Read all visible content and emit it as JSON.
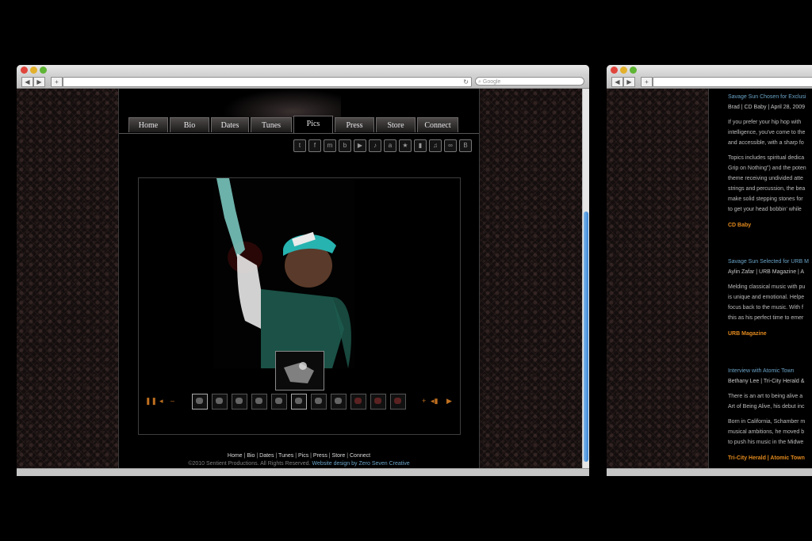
{
  "browser": {
    "search_placeholder": "Google"
  },
  "site": {
    "nav_tabs": [
      "Home",
      "Bio",
      "Dates",
      "Tunes",
      "Pics",
      "Press",
      "Store",
      "Connect"
    ],
    "active_tab": "Pics",
    "social_icons": [
      "twitter-icon",
      "facebook-icon",
      "myspace-icon",
      "bebo-icon",
      "youtube-icon",
      "itunes-icon",
      "amazon-icon",
      "star-icon",
      "chart-icon",
      "music-icon",
      "lastfm-icon",
      "blogger-icon"
    ],
    "footer": {
      "links": [
        "Home",
        "Bio",
        "Dates",
        "Tunes",
        "Pics",
        "Press",
        "Store",
        "Connect"
      ],
      "copyright": "©2010 Sentient Productions. All Rights Reserved.",
      "credit": "Website design by Zero Seven Creative"
    },
    "accent_color": "#e38a1d",
    "link_color": "#6aa4c8"
  },
  "press": {
    "articles": [
      {
        "title": "Savage Sun Chosen for Exclusi",
        "meta": "Brad | CD Baby | April 28, 2009",
        "paragraphs": [
          [
            "If you prefer your hip hop with",
            "intelligence, you've come to the",
            "and accessible, with a sharp fo"
          ],
          [
            "Topics includes spiritual dedica",
            "Grip on Nothing\") and the poten",
            "theme receiving undivided atte",
            "strings and percussion, the bea",
            "make solid stepping stones for",
            "to get your head bobbin' while"
          ]
        ],
        "source": "CD Baby"
      },
      {
        "title": "Savage Sun Selected for URB M",
        "meta": "Aylin Zafar | URB Magazine | A",
        "paragraphs": [
          [
            "Melding classical music with pu",
            "is unique and emotional. Helpe",
            "focus back to the music. With f",
            "this as his perfect time to emer"
          ]
        ],
        "source": "URB Magazine"
      },
      {
        "title": "Interview with Atomic Town",
        "meta": "Bethany Lee | Tri-City Herald &",
        "paragraphs": [
          [
            "There is an art to being alive a",
            "Art of Being Alive, his debut inc"
          ],
          [
            "Born in California, Schamber m",
            "musical ambitions, he moved b",
            "to push his music in the Midwe"
          ]
        ],
        "source": "Tri-City Herald | Atomic Town"
      }
    ]
  }
}
